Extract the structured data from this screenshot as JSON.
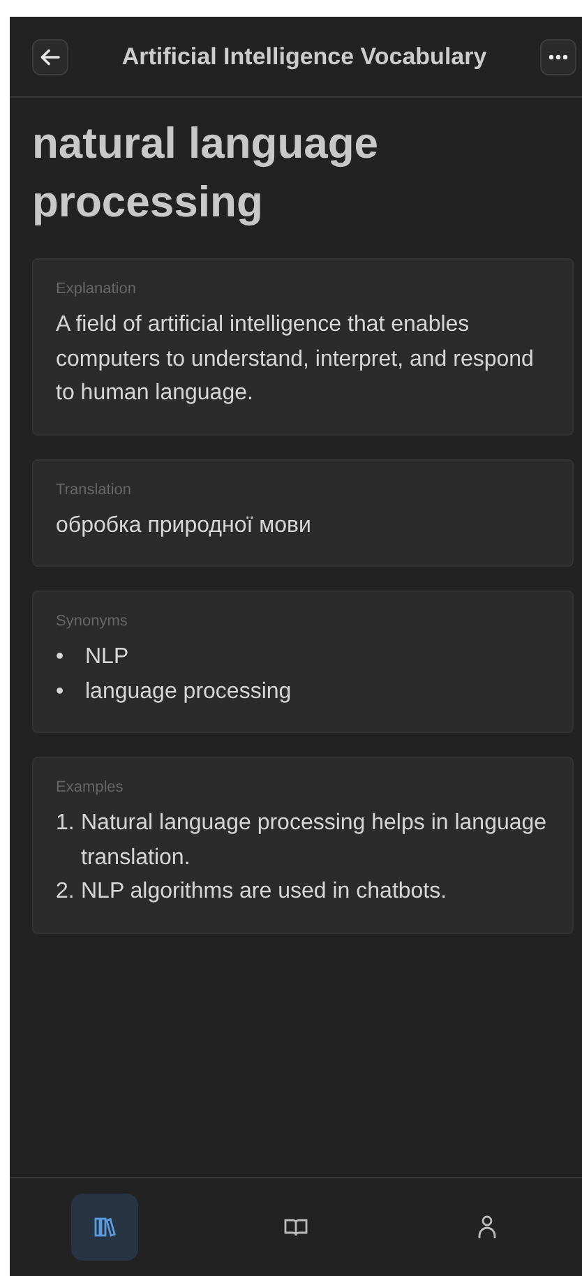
{
  "header": {
    "title": "Artificial Intelligence Vocabulary"
  },
  "term": "natural language processing",
  "sections": [
    {
      "kind": "text",
      "label": "Explanation",
      "text": "A field of artificial intelligence that enables computers to understand, interpret, and respond to human language."
    },
    {
      "kind": "text",
      "label": "Translation",
      "text": "обробка природної мови"
    },
    {
      "kind": "list",
      "label": "Synonyms",
      "items": [
        {
          "marker": "•",
          "text": "NLP"
        },
        {
          "marker": "•",
          "text": "language processing"
        }
      ]
    },
    {
      "kind": "list",
      "label": "Examples",
      "items": [
        {
          "marker": "1.",
          "text": "Natural language processing helps in language translation."
        },
        {
          "marker": "2.",
          "text": "NLP algorithms are used in chatbots."
        }
      ]
    }
  ],
  "nav": [
    {
      "kind": "library",
      "selected": true
    },
    {
      "kind": "book",
      "selected": false
    },
    {
      "kind": "person",
      "selected": false
    }
  ]
}
